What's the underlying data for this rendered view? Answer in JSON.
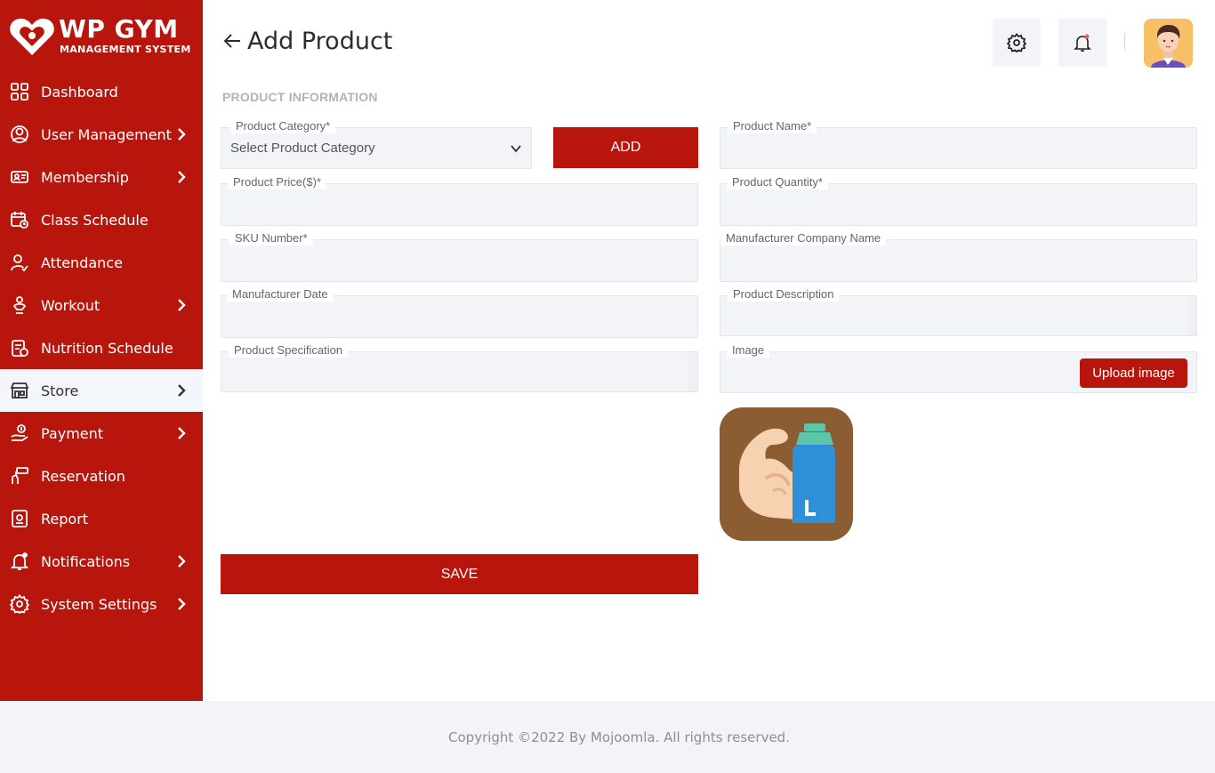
{
  "brand": {
    "title": "WP GYM",
    "subtitle": "MANAGEMENT SYSTEM",
    "color": "#b8160d"
  },
  "sidebar": {
    "items": [
      {
        "label": "Dashboard",
        "icon": "dashboard-icon",
        "has_submenu": false
      },
      {
        "label": "User Management",
        "icon": "users-icon",
        "has_submenu": true
      },
      {
        "label": "Membership",
        "icon": "membership-card-icon",
        "has_submenu": true
      },
      {
        "label": "Class Schedule",
        "icon": "calendar-icon",
        "has_submenu": false
      },
      {
        "label": "Attendance",
        "icon": "user-check-icon",
        "has_submenu": false
      },
      {
        "label": "Workout",
        "icon": "workout-icon",
        "has_submenu": true
      },
      {
        "label": "Nutrition Schedule",
        "icon": "nutrition-icon",
        "has_submenu": false
      },
      {
        "label": "Store",
        "icon": "store-icon",
        "has_submenu": true,
        "active": true
      },
      {
        "label": "Payment",
        "icon": "payment-icon",
        "has_submenu": true
      },
      {
        "label": "Reservation",
        "icon": "reservation-icon",
        "has_submenu": false
      },
      {
        "label": "Report",
        "icon": "report-icon",
        "has_submenu": false
      },
      {
        "label": "Notifications",
        "icon": "bell-icon",
        "has_submenu": true
      },
      {
        "label": "System Settings",
        "icon": "gear-icon",
        "has_submenu": true
      }
    ]
  },
  "header": {
    "title": "Add Product",
    "settings_icon": "gear-icon",
    "notification_icon": "bell-icon",
    "notification_dot_color": "#ec5f55"
  },
  "form": {
    "section_title": "PRODUCT INFORMATION",
    "category": {
      "label": "Product Category*",
      "value": "Select Product Category"
    },
    "add_button": "ADD",
    "product_name": {
      "label": "Product Name*",
      "value": ""
    },
    "price": {
      "label": "Product Price($)*",
      "value": ""
    },
    "quantity": {
      "label": "Product Quantity*",
      "value": ""
    },
    "sku": {
      "label": "SKU Number*",
      "value": ""
    },
    "manufacturer_company": {
      "label": "Manufacturer Company Name",
      "value": ""
    },
    "manufacturer_date": {
      "label": "Manufacturer Date",
      "value": ""
    },
    "description": {
      "label": "Product Description",
      "value": ""
    },
    "specification": {
      "label": "Product Specification",
      "value": ""
    },
    "image": {
      "label": "Image",
      "upload_button": "Upload image",
      "preview_icon": "protein-bottle-bicep-icon"
    },
    "save_button": "SAVE"
  },
  "footer": {
    "copyright": "Copyright ©2022 By Mojoomla. All rights reserved."
  }
}
